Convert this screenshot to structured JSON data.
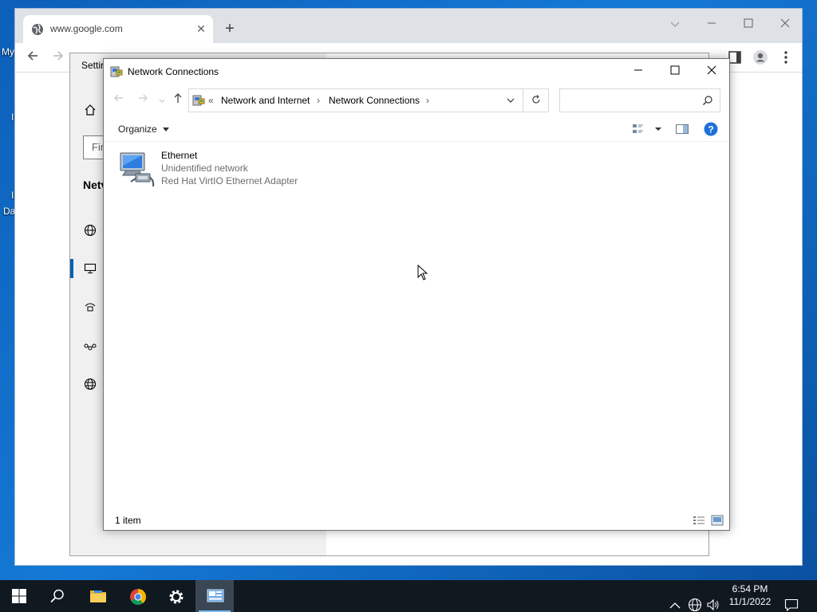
{
  "desktop": {
    "fragments": [
      "My",
      "I",
      "I",
      "Da"
    ]
  },
  "browser": {
    "tab_title": "www.google.com",
    "tab_close": "✕",
    "new_tab": "+"
  },
  "settings_window": {
    "title": "Settir",
    "find_placeholder": "Fir",
    "section_heading": "Netv"
  },
  "explorer": {
    "title": "Network Connections",
    "breadcrumb": {
      "overflow": "«",
      "items": [
        "Network and Internet",
        "Network Connections"
      ],
      "separator": "›"
    },
    "search_placeholder": "",
    "organize_label": "Organize",
    "items": [
      {
        "name": "Ethernet",
        "status": "Unidentified network",
        "device": "Red Hat VirtIO Ethernet Adapter"
      }
    ],
    "status_count": "1 item"
  },
  "taskbar": {
    "time": "6:54 PM",
    "date": "11/1/2022",
    "apps": [
      "start",
      "search",
      "file-explorer",
      "chrome",
      "settings",
      "network-connections"
    ]
  },
  "colors": {
    "desktop_blue": "#1479d6",
    "taskbar": "#101820",
    "accent": "#0063b1",
    "help_blue": "#1e6fd9"
  }
}
